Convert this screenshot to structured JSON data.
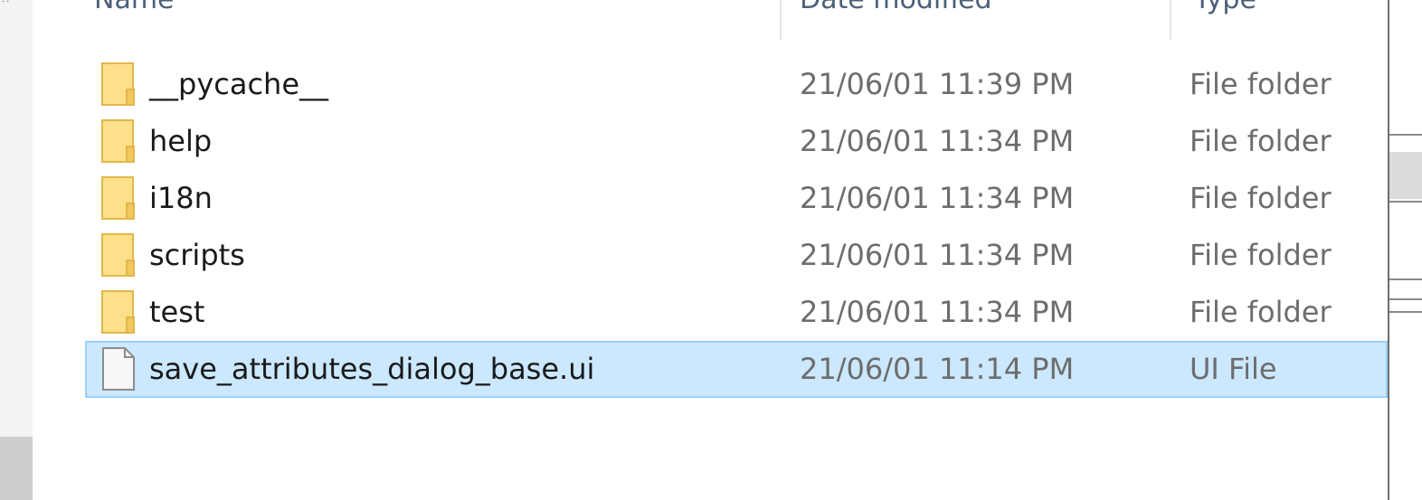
{
  "columns": {
    "name": "Name",
    "date_modified": "Date modified",
    "type": "Type"
  },
  "rows": [
    {
      "name": "__pycache__",
      "date": "21/06/01 11:39 PM",
      "type": "File folder",
      "icon": "folder-icon",
      "selected": false
    },
    {
      "name": "help",
      "date": "21/06/01 11:34 PM",
      "type": "File folder",
      "icon": "folder-icon",
      "selected": false
    },
    {
      "name": "i18n",
      "date": "21/06/01 11:34 PM",
      "type": "File folder",
      "icon": "folder-icon",
      "selected": false
    },
    {
      "name": "scripts",
      "date": "21/06/01 11:34 PM",
      "type": "File folder",
      "icon": "folder-icon",
      "selected": false
    },
    {
      "name": "test",
      "date": "21/06/01 11:34 PM",
      "type": "File folder",
      "icon": "folder-icon",
      "selected": false
    },
    {
      "name": "save_attributes_dialog_base.ui",
      "date": "21/06/01 11:14 PM",
      "type": "UI File",
      "icon": "file-icon",
      "selected": true
    }
  ],
  "colors": {
    "selection_bg": "#cce8ff",
    "selection_border": "#99d1ff",
    "folder_yellow": "#ffe08a",
    "header_text": "#4c607a"
  }
}
